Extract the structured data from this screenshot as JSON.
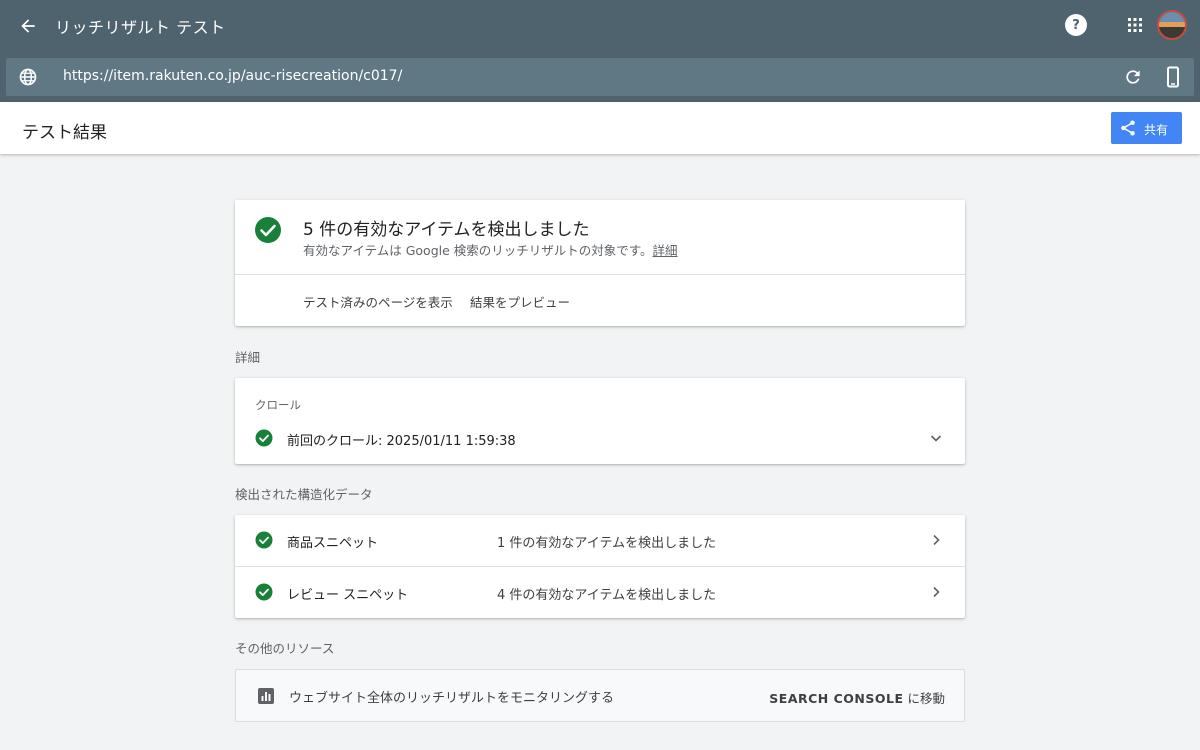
{
  "header": {
    "app_title": "リッチリザルト テスト",
    "help_label": "?",
    "url": "https://item.rakuten.co.jp/auc-risecreation/c017/",
    "accent_color": "#4f636e"
  },
  "subheader": {
    "page_title": "テスト結果",
    "share_label": "共有"
  },
  "summary": {
    "title": "5 件の有効なアイテムを検出しました",
    "description": "有効なアイテムは Google 検索のリッチリザルトの対象です。",
    "details_link": "詳細",
    "actions": [
      "テスト済みのページを表示",
      "結果をプレビュー"
    ]
  },
  "details": {
    "section_label": "詳細",
    "crawl": {
      "heading": "クロール",
      "last_crawl": "前回のクロール: 2025/01/11 1:59:38"
    }
  },
  "structured_data": {
    "section_label": "検出された構造化データ",
    "rows": [
      {
        "name": "商品スニペット",
        "status": "1 件の有効なアイテムを検出しました"
      },
      {
        "name": "レビュー スニペット",
        "status": "4 件の有効なアイテムを検出しました"
      }
    ]
  },
  "resources": {
    "section_label": "その他のリソース",
    "item_text": "ウェブサイト全体のリッチリザルトをモニタリングする",
    "link_caps": "SEARCH CONSOLE",
    "link_suffix": " に移動"
  },
  "colors": {
    "success": "#188038",
    "primary": "#4285f4"
  }
}
